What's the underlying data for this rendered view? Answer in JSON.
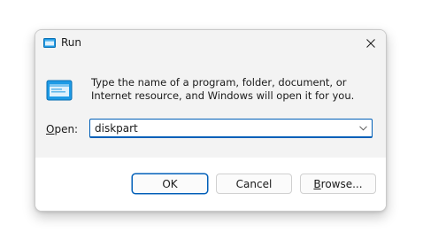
{
  "window": {
    "title": "Run",
    "icon": "run-icon"
  },
  "description": "Type the name of a program, folder, document, or Internet resource, and Windows will open it for you.",
  "open_field": {
    "label": "Open:",
    "value": "diskpart"
  },
  "buttons": {
    "ok": "OK",
    "cancel": "Cancel",
    "browse": "Browse..."
  },
  "colors": {
    "accent": "#005fb8",
    "icon_blue": "#1e9be6"
  }
}
